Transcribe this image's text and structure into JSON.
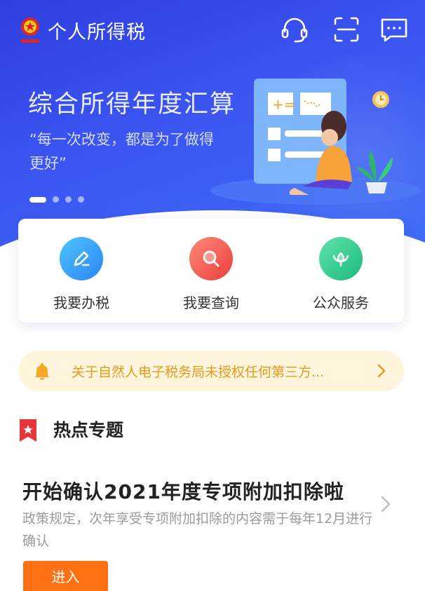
{
  "header": {
    "title": "个人所得税",
    "icons": [
      "emblem-icon",
      "customer-service-icon",
      "scan-icon",
      "message-icon"
    ]
  },
  "banner": {
    "title": "综合所得年度汇算",
    "quote": "“每一次改变，都是为了做得更好”",
    "slide_count": 4,
    "active_slide": 1
  },
  "quick_actions": [
    {
      "label": "我要办税",
      "icon": "edit-icon",
      "color": "#2e9cf7"
    },
    {
      "label": "我要查询",
      "icon": "search-icon",
      "color": "#f05a4a"
    },
    {
      "label": "公众服务",
      "icon": "flower-icon",
      "color": "#2ecb8a"
    }
  ],
  "notice": {
    "text": "关于自然人电子税务局未授权任何第三方..."
  },
  "hot_topics": {
    "title": "热点专题"
  },
  "article": {
    "title": "开始确认2021年度专项附加扣除啦",
    "description": "政策规定，次年享受专项附加扣除的内容需于每年12月进行确认",
    "button_label": "进入"
  },
  "colors": {
    "primary_blue": "#3c56f2",
    "accent_orange": "#ff7012",
    "notice_bg": "#fff5dd",
    "notice_text": "#e69a1c"
  }
}
